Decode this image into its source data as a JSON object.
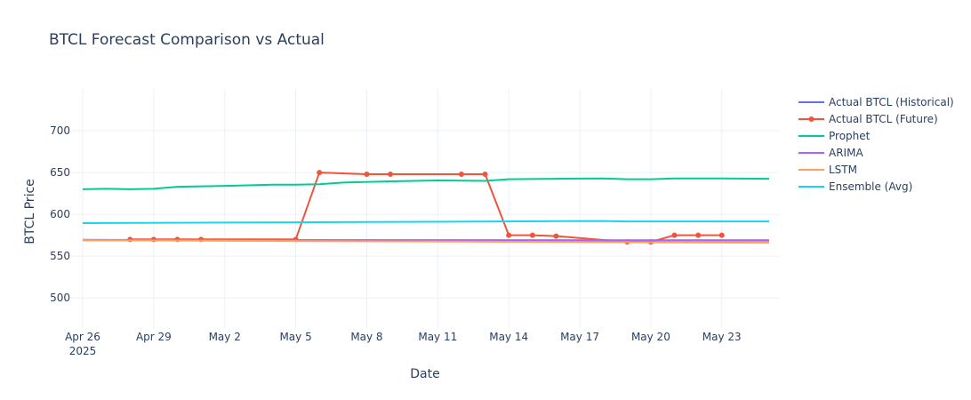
{
  "chart_data": {
    "type": "line",
    "title": "BTCL Forecast Comparison vs Actual",
    "xlabel": "Date",
    "ylabel": "BTCL Price",
    "xrange": [
      "2025-04-26",
      "2025-05-25"
    ],
    "ylim": [
      463,
      750
    ],
    "yticks": [
      500,
      550,
      600,
      650,
      700
    ],
    "xticks": [
      {
        "date": "2025-04-26",
        "label": "Apr 26",
        "sub": "2025"
      },
      {
        "date": "2025-04-29",
        "label": "Apr 29",
        "sub": ""
      },
      {
        "date": "2025-05-02",
        "label": "May 2",
        "sub": ""
      },
      {
        "date": "2025-05-05",
        "label": "May 5",
        "sub": ""
      },
      {
        "date": "2025-05-08",
        "label": "May 8",
        "sub": ""
      },
      {
        "date": "2025-05-11",
        "label": "May 11",
        "sub": ""
      },
      {
        "date": "2025-05-14",
        "label": "May 14",
        "sub": ""
      },
      {
        "date": "2025-05-17",
        "label": "May 17",
        "sub": ""
      },
      {
        "date": "2025-05-20",
        "label": "May 20",
        "sub": ""
      },
      {
        "date": "2025-05-23",
        "label": "May 23",
        "sub": ""
      }
    ],
    "grid": true,
    "legend": "right",
    "series": [
      {
        "name": "Actual BTCL (Historical)",
        "color": "#636efa",
        "markers": false,
        "x": [
          "2025-04-26",
          "2025-05-25"
        ],
        "y": [
          569,
          569
        ]
      },
      {
        "name": "Actual BTCL (Future)",
        "color": "#ef553b",
        "markers": true,
        "x": [
          "2025-04-28",
          "2025-04-29",
          "2025-04-30",
          "2025-05-01",
          "2025-05-05",
          "2025-05-06",
          "2025-05-08",
          "2025-05-09",
          "2025-05-12",
          "2025-05-13",
          "2025-05-14",
          "2025-05-15",
          "2025-05-16",
          "2025-05-19",
          "2025-05-20",
          "2025-05-21",
          "2025-05-22",
          "2025-05-23"
        ],
        "y": [
          570,
          570,
          570,
          570,
          570,
          650,
          648,
          648,
          648,
          648,
          575,
          575,
          574,
          567,
          567,
          575,
          575,
          575
        ]
      },
      {
        "name": "Prophet",
        "color": "#00cc96",
        "markers": false,
        "x": [
          "2025-04-26",
          "2025-04-27",
          "2025-04-28",
          "2025-04-29",
          "2025-04-30",
          "2025-05-02",
          "2025-05-04",
          "2025-05-05",
          "2025-05-06",
          "2025-05-07",
          "2025-05-09",
          "2025-05-11",
          "2025-05-13",
          "2025-05-14",
          "2025-05-16",
          "2025-05-18",
          "2025-05-19",
          "2025-05-20",
          "2025-05-21",
          "2025-05-23",
          "2025-05-25"
        ],
        "y": [
          630,
          630.5,
          630,
          630.5,
          633,
          634,
          635.5,
          635.5,
          636,
          638,
          639.5,
          640.5,
          640,
          642,
          642.5,
          643,
          642,
          642,
          643,
          643,
          642.5
        ]
      },
      {
        "name": "ARIMA",
        "color": "#ab63fa",
        "markers": false,
        "x": [
          "2025-04-26",
          "2025-05-25"
        ],
        "y": [
          569.5,
          568.5
        ]
      },
      {
        "name": "LSTM",
        "color": "#ffa15a",
        "markers": false,
        "x": [
          "2025-04-26",
          "2025-05-25"
        ],
        "y": [
          569,
          566
        ]
      },
      {
        "name": "Ensemble (Avg)",
        "color": "#19d3f3",
        "markers": false,
        "x": [
          "2025-04-26",
          "2025-05-05",
          "2025-05-18",
          "2025-05-19",
          "2025-05-25"
        ],
        "y": [
          589.5,
          590.5,
          592,
          591.5,
          591.5
        ]
      }
    ]
  }
}
